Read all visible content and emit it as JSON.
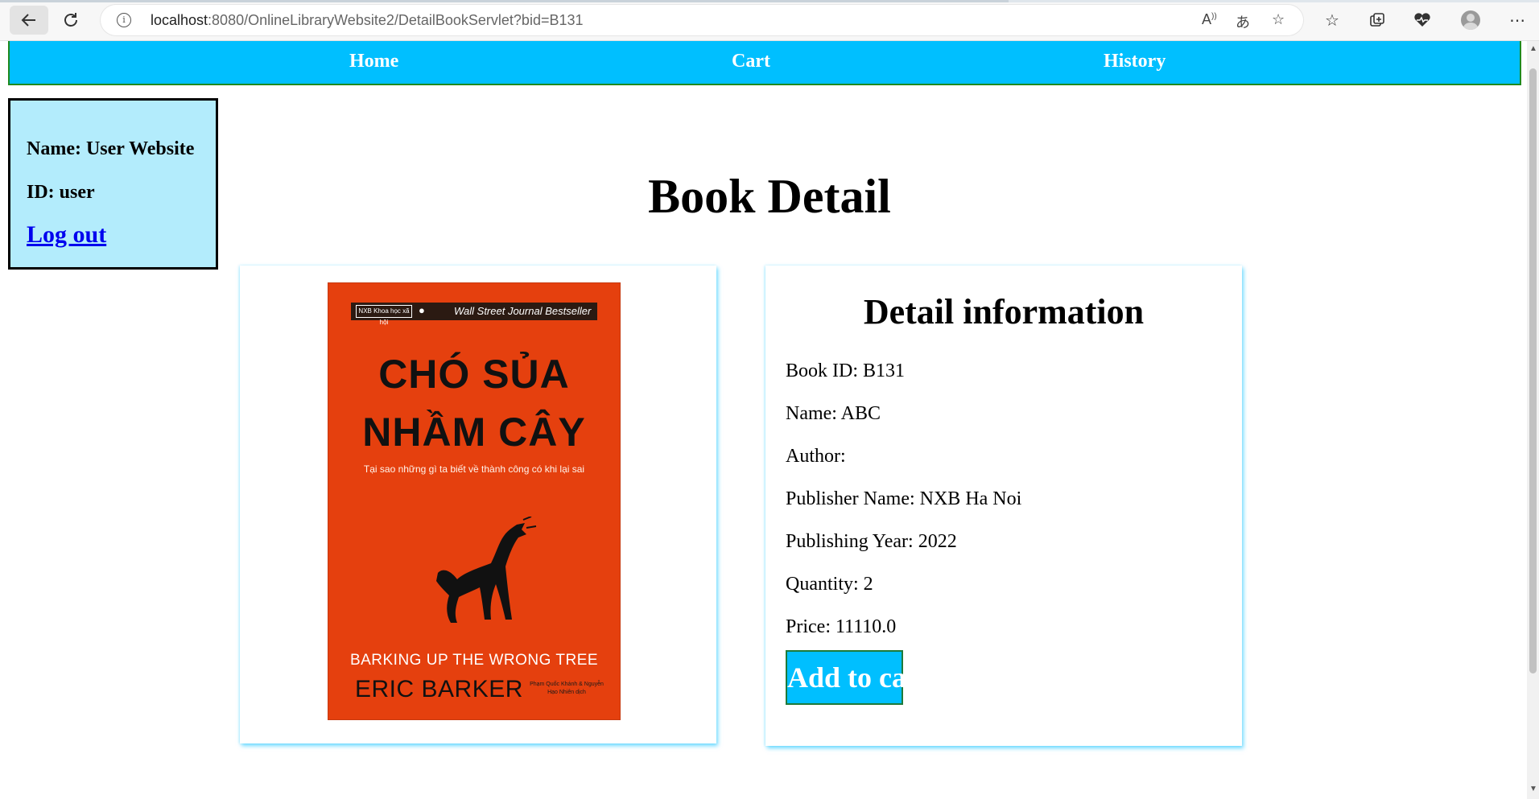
{
  "browser": {
    "url_host": "localhost",
    "url_path": ":8080/OnlineLibraryWebsite2/DetailBookServlet?bid=B131",
    "icons": [
      "back-icon",
      "reload-icon",
      "info-icon",
      "read-aloud-icon",
      "translate-icon",
      "add-favorite-icon",
      "favorites-icon",
      "collections-icon",
      "browser-essentials-icon",
      "profile-avatar-icon",
      "more-options-icon"
    ]
  },
  "nav": {
    "home": "Home",
    "cart": "Cart",
    "history": "History"
  },
  "user": {
    "name": "Name: User Website",
    "id": "ID: user",
    "logout": "Log out"
  },
  "page": {
    "title": "Book Detail"
  },
  "book": {
    "cover": {
      "badge": "Wall Street Journal Bestseller",
      "publisher_logo": "NXB Khoa học xã hội",
      "title_line1": "CHÓ SỦA",
      "title_line2": "NHẦM CÂY",
      "subtitle": "Tại sao những gì ta biết về thành công có khi lại sai",
      "english_title": "BARKING UP THE WRONG TREE",
      "author": "ERIC BARKER",
      "translators": "Phạm Quốc Khánh & Nguyễn Hạo Nhiên dịch"
    }
  },
  "detail": {
    "heading": "Detail information",
    "book_id": "Book ID: B131",
    "name": "Name: ABC",
    "author": "Author:",
    "publisher": "Publisher Name: NXB Ha Noi",
    "year": "Publishing Year: 2022",
    "quantity": "Quantity: 2",
    "price": "Price: 11110.0",
    "add_button": "Add to cart"
  },
  "colors": {
    "nav_bg": "#00bfff",
    "user_box_bg": "#b3ecfc",
    "button_bg": "#00bfff",
    "cover_bg": "#e5400e"
  }
}
